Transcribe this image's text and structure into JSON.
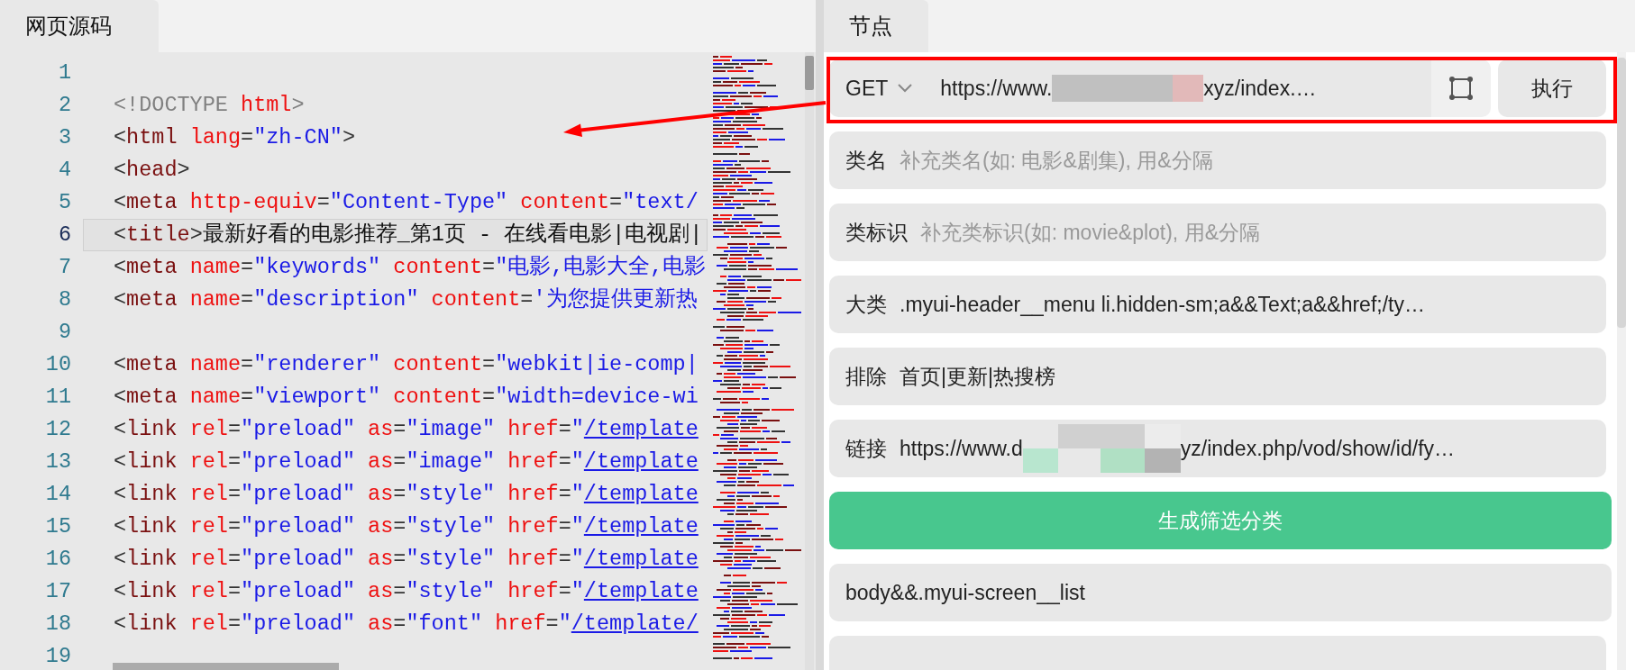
{
  "source_panel": {
    "tab": {
      "label": "网页源码",
      "selected": true
    },
    "lines": [
      {
        "number": "1",
        "selected": false
      },
      {
        "number": "2",
        "selected": false,
        "tokens": [
          {
            "kind": "doctype",
            "text": "<!DOCTYPE"
          },
          {
            "kind": "attr",
            "text": " html"
          },
          {
            "kind": "doctype",
            "text": ">"
          }
        ]
      },
      {
        "number": "3",
        "selected": false,
        "tokens": [
          {
            "kind": "punct",
            "text": "<"
          },
          {
            "kind": "tag",
            "text": "html"
          },
          {
            "kind": "attr",
            "text": " lang"
          },
          {
            "kind": "punct",
            "text": "="
          },
          {
            "kind": "string",
            "text": "\"zh-CN\""
          },
          {
            "kind": "punct",
            "text": ">"
          }
        ]
      },
      {
        "number": "4",
        "selected": false,
        "tokens": [
          {
            "kind": "punct",
            "text": "<"
          },
          {
            "kind": "tag",
            "text": "head"
          },
          {
            "kind": "punct",
            "text": ">"
          }
        ]
      },
      {
        "number": "5",
        "selected": false,
        "tokens": [
          {
            "kind": "punct",
            "text": "<"
          },
          {
            "kind": "tag",
            "text": "meta"
          },
          {
            "kind": "attr",
            "text": " http-equiv"
          },
          {
            "kind": "punct",
            "text": "="
          },
          {
            "kind": "string",
            "text": "\"Content-Type\""
          },
          {
            "kind": "attr",
            "text": " content"
          },
          {
            "kind": "punct",
            "text": "="
          },
          {
            "kind": "string",
            "text": "\"text/"
          }
        ]
      },
      {
        "number": "6",
        "selected": true,
        "tokens": [
          {
            "kind": "punct",
            "text": "<"
          },
          {
            "kind": "tag",
            "text": "title"
          },
          {
            "kind": "punct",
            "text": ">"
          },
          {
            "kind": "text",
            "text": "最新好看的电影推荐_第1页 - 在线看电影|电视剧|"
          }
        ]
      },
      {
        "number": "7",
        "selected": false,
        "tokens": [
          {
            "kind": "punct",
            "text": "<"
          },
          {
            "kind": "tag",
            "text": "meta"
          },
          {
            "kind": "attr",
            "text": " name"
          },
          {
            "kind": "punct",
            "text": "="
          },
          {
            "kind": "string",
            "text": "\"keywords\""
          },
          {
            "kind": "attr",
            "text": " content"
          },
          {
            "kind": "punct",
            "text": "="
          },
          {
            "kind": "string",
            "text": "\"电影,电影大全,电影"
          }
        ]
      },
      {
        "number": "8",
        "selected": false,
        "tokens": [
          {
            "kind": "punct",
            "text": "<"
          },
          {
            "kind": "tag",
            "text": "meta"
          },
          {
            "kind": "attr",
            "text": " name"
          },
          {
            "kind": "punct",
            "text": "="
          },
          {
            "kind": "string",
            "text": "\"description\""
          },
          {
            "kind": "attr",
            "text": " content"
          },
          {
            "kind": "punct",
            "text": "="
          },
          {
            "kind": "string",
            "text": "'为您提供更新热"
          }
        ]
      },
      {
        "number": "9",
        "selected": false
      },
      {
        "number": "10",
        "selected": false,
        "tokens": [
          {
            "kind": "punct",
            "text": "<"
          },
          {
            "kind": "tag",
            "text": "meta"
          },
          {
            "kind": "attr",
            "text": " name"
          },
          {
            "kind": "punct",
            "text": "="
          },
          {
            "kind": "string",
            "text": "\"renderer\""
          },
          {
            "kind": "attr",
            "text": " content"
          },
          {
            "kind": "punct",
            "text": "="
          },
          {
            "kind": "string",
            "text": "\"webkit|ie-comp|"
          }
        ]
      },
      {
        "number": "11",
        "selected": false,
        "tokens": [
          {
            "kind": "punct",
            "text": "<"
          },
          {
            "kind": "tag",
            "text": "meta"
          },
          {
            "kind": "attr",
            "text": " name"
          },
          {
            "kind": "punct",
            "text": "="
          },
          {
            "kind": "string",
            "text": "\"viewport\""
          },
          {
            "kind": "attr",
            "text": " content"
          },
          {
            "kind": "punct",
            "text": "="
          },
          {
            "kind": "string",
            "text": "\"width=device-wi"
          }
        ]
      },
      {
        "number": "12",
        "selected": false,
        "tokens": [
          {
            "kind": "punct",
            "text": "<"
          },
          {
            "kind": "tag",
            "text": "link"
          },
          {
            "kind": "attr",
            "text": " rel"
          },
          {
            "kind": "punct",
            "text": "="
          },
          {
            "kind": "string",
            "text": "\"preload\""
          },
          {
            "kind": "attr",
            "text": " as"
          },
          {
            "kind": "punct",
            "text": "="
          },
          {
            "kind": "string",
            "text": "\"image\""
          },
          {
            "kind": "attr",
            "text": " href"
          },
          {
            "kind": "punct",
            "text": "="
          },
          {
            "kind": "string",
            "text": "\""
          },
          {
            "kind": "link",
            "text": "/template"
          }
        ]
      },
      {
        "number": "13",
        "selected": false,
        "tokens": [
          {
            "kind": "punct",
            "text": "<"
          },
          {
            "kind": "tag",
            "text": "link"
          },
          {
            "kind": "attr",
            "text": " rel"
          },
          {
            "kind": "punct",
            "text": "="
          },
          {
            "kind": "string",
            "text": "\"preload\""
          },
          {
            "kind": "attr",
            "text": " as"
          },
          {
            "kind": "punct",
            "text": "="
          },
          {
            "kind": "string",
            "text": "\"image\""
          },
          {
            "kind": "attr",
            "text": " href"
          },
          {
            "kind": "punct",
            "text": "="
          },
          {
            "kind": "string",
            "text": "\""
          },
          {
            "kind": "link",
            "text": "/template"
          }
        ]
      },
      {
        "number": "14",
        "selected": false,
        "tokens": [
          {
            "kind": "punct",
            "text": "<"
          },
          {
            "kind": "tag",
            "text": "link"
          },
          {
            "kind": "attr",
            "text": " rel"
          },
          {
            "kind": "punct",
            "text": "="
          },
          {
            "kind": "string",
            "text": "\"preload\""
          },
          {
            "kind": "attr",
            "text": " as"
          },
          {
            "kind": "punct",
            "text": "="
          },
          {
            "kind": "string",
            "text": "\"style\""
          },
          {
            "kind": "attr",
            "text": " href"
          },
          {
            "kind": "punct",
            "text": "="
          },
          {
            "kind": "string",
            "text": "\""
          },
          {
            "kind": "link",
            "text": "/template"
          }
        ]
      },
      {
        "number": "15",
        "selected": false,
        "tokens": [
          {
            "kind": "punct",
            "text": "<"
          },
          {
            "kind": "tag",
            "text": "link"
          },
          {
            "kind": "attr",
            "text": " rel"
          },
          {
            "kind": "punct",
            "text": "="
          },
          {
            "kind": "string",
            "text": "\"preload\""
          },
          {
            "kind": "attr",
            "text": " as"
          },
          {
            "kind": "punct",
            "text": "="
          },
          {
            "kind": "string",
            "text": "\"style\""
          },
          {
            "kind": "attr",
            "text": " href"
          },
          {
            "kind": "punct",
            "text": "="
          },
          {
            "kind": "string",
            "text": "\""
          },
          {
            "kind": "link",
            "text": "/template"
          }
        ]
      },
      {
        "number": "16",
        "selected": false,
        "tokens": [
          {
            "kind": "punct",
            "text": "<"
          },
          {
            "kind": "tag",
            "text": "link"
          },
          {
            "kind": "attr",
            "text": " rel"
          },
          {
            "kind": "punct",
            "text": "="
          },
          {
            "kind": "string",
            "text": "\"preload\""
          },
          {
            "kind": "attr",
            "text": " as"
          },
          {
            "kind": "punct",
            "text": "="
          },
          {
            "kind": "string",
            "text": "\"style\""
          },
          {
            "kind": "attr",
            "text": " href"
          },
          {
            "kind": "punct",
            "text": "="
          },
          {
            "kind": "string",
            "text": "\""
          },
          {
            "kind": "link",
            "text": "/template"
          }
        ]
      },
      {
        "number": "17",
        "selected": false,
        "tokens": [
          {
            "kind": "punct",
            "text": "<"
          },
          {
            "kind": "tag",
            "text": "link"
          },
          {
            "kind": "attr",
            "text": " rel"
          },
          {
            "kind": "punct",
            "text": "="
          },
          {
            "kind": "string",
            "text": "\"preload\""
          },
          {
            "kind": "attr",
            "text": " as"
          },
          {
            "kind": "punct",
            "text": "="
          },
          {
            "kind": "string",
            "text": "\"style\""
          },
          {
            "kind": "attr",
            "text": " href"
          },
          {
            "kind": "punct",
            "text": "="
          },
          {
            "kind": "string",
            "text": "\""
          },
          {
            "kind": "link",
            "text": "/template"
          }
        ]
      },
      {
        "number": "18",
        "selected": false,
        "tokens": [
          {
            "kind": "punct",
            "text": "<"
          },
          {
            "kind": "tag",
            "text": "link"
          },
          {
            "kind": "attr",
            "text": " rel"
          },
          {
            "kind": "punct",
            "text": "="
          },
          {
            "kind": "string",
            "text": "\"preload\""
          },
          {
            "kind": "attr",
            "text": " as"
          },
          {
            "kind": "punct",
            "text": "="
          },
          {
            "kind": "string",
            "text": "\"font\""
          },
          {
            "kind": "attr",
            "text": " href"
          },
          {
            "kind": "punct",
            "text": "="
          },
          {
            "kind": "string",
            "text": "\""
          },
          {
            "kind": "link",
            "text": "/template/"
          }
        ]
      },
      {
        "number": "19",
        "selected": false
      }
    ]
  },
  "node_panel": {
    "tab": {
      "label": "节点",
      "selected": true
    },
    "request": {
      "method": "GET",
      "url_start": "https://www.",
      "url_end": "xyz/index.…",
      "run_button": "执行"
    },
    "fields": [
      {
        "kind": "placeholder",
        "label": "类名",
        "placeholder": "补充类名(如: 电影&剧集), 用&分隔"
      },
      {
        "kind": "placeholder",
        "label": "类标识",
        "placeholder": "补充类标识(如: movie&plot), 用&分隔"
      },
      {
        "kind": "value",
        "label": "大类",
        "value": ".myui-header__menu li.hidden-sm;a&&Text;a&&href;/ty…"
      },
      {
        "kind": "value",
        "label": "排除",
        "value": "首页|更新|热搜榜"
      },
      {
        "kind": "redacted",
        "label": "链接",
        "value_start": "https://www.d",
        "value_end": "yz/index.php/vod/show/id/fy…"
      }
    ],
    "generate_button": "生成筛选分类",
    "rules": [
      {
        "kind": "value",
        "value": "body&&.myui-screen__list"
      },
      {
        "kind": "cut"
      }
    ]
  }
}
